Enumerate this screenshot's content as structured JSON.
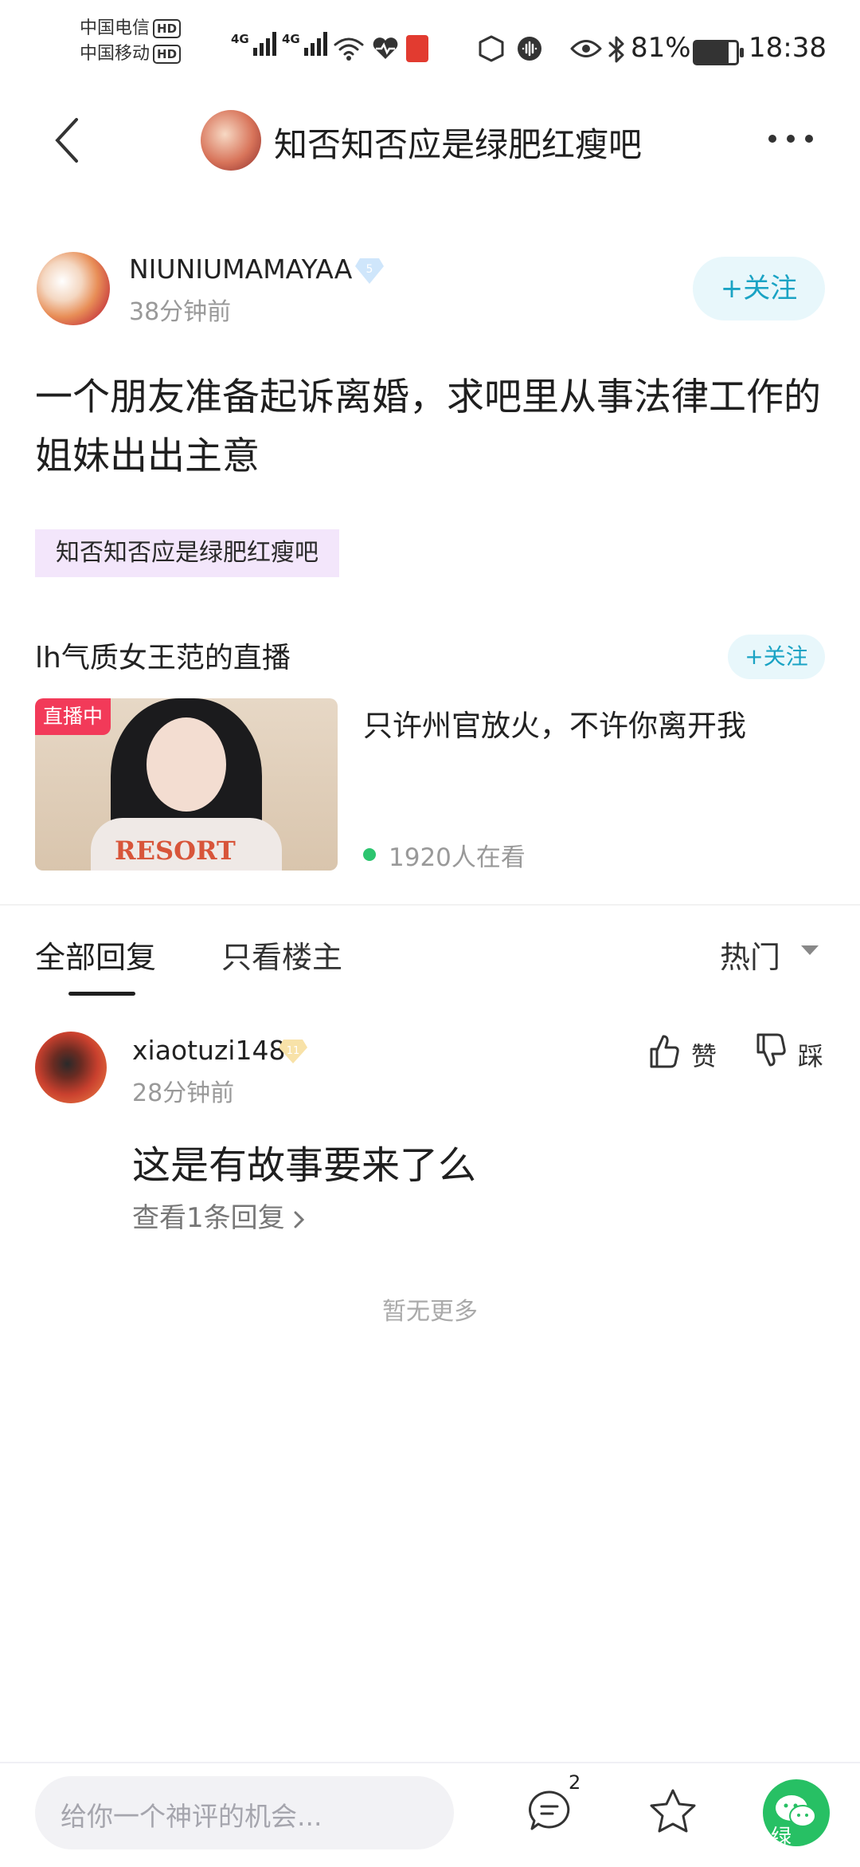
{
  "status_bar": {
    "carrier_1": "中国电信",
    "carrier_2": "中国移动",
    "hd": "HD",
    "network_1": "4G",
    "network_2": "4G",
    "battery_percent": "81%",
    "battery_level": 0.81,
    "time": "18:38"
  },
  "nav": {
    "title": "知否知否应是绿肥红瘦吧"
  },
  "post": {
    "author": "NIUNIUMAMAYAA",
    "author_level": "5",
    "time": "38分钟前",
    "follow_label": "+关注",
    "title": "一个朋友准备起诉离婚，求吧里从事法律工作的姐妹出出主意",
    "forum_tag": "知否知否应是绿肥红瘦吧"
  },
  "live": {
    "header": "lh气质女王范的直播",
    "follow_label": "+关注",
    "badge": "直播中",
    "caption": "只许州官放火，不许你离开我",
    "viewers": "1920人在看"
  },
  "tabs": {
    "all": "全部回复",
    "op_only": "只看楼主",
    "sort": "热门"
  },
  "comment": {
    "user": "xiaotuzi148",
    "user_level": "11",
    "time": "28分钟前",
    "like_label": "赞",
    "dislike_label": "踩",
    "text": "这是有故事要来了么",
    "replies_link": "查看1条回复"
  },
  "footer_note": "暂无更多",
  "bottom_bar": {
    "input_placeholder": "给你一个神评的机会...",
    "comment_count": "2",
    "share_label": "绿"
  },
  "colors": {
    "accent": "#1aa3c4",
    "live_badge": "#f23a59",
    "online_dot": "#2cc56f",
    "tag_bg": "#f3e6fb",
    "wechat": "#27c064"
  },
  "icons": [
    "back-icon",
    "more-icon",
    "level-diamond-icon",
    "thumb-up-icon",
    "thumb-down-icon",
    "chevron-right-icon",
    "caret-down-icon",
    "comment-icon",
    "star-icon",
    "wechat-icon",
    "wifi-icon",
    "bluetooth-icon",
    "eye-icon",
    "battery-icon"
  ]
}
